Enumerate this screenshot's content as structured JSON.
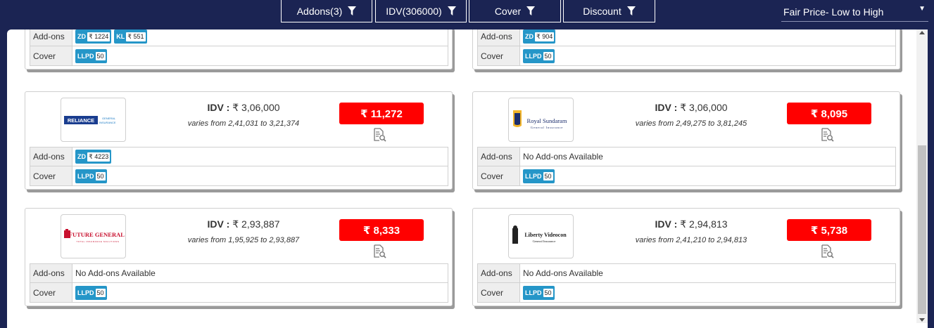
{
  "filters": {
    "addons": "Addons(3)",
    "idv": "IDV(306000)",
    "cover": "Cover",
    "discount": "Discount"
  },
  "sort": {
    "selected": "Fair Price- Low to High"
  },
  "labels": {
    "addons": "Add-ons",
    "cover": "Cover",
    "idv_label": "IDV :",
    "no_addons": "No Add-ons Available"
  },
  "partial_cards": [
    {
      "addon_tags": [
        {
          "code": "ZD",
          "value": "₹ 1224"
        },
        {
          "code": "KL",
          "value": "₹ 551"
        }
      ],
      "cover_tag": {
        "code": "LLPD",
        "value": "50"
      }
    },
    {
      "addon_tags": [
        {
          "code": "ZD",
          "value": "₹ 904"
        }
      ],
      "cover_tag": {
        "code": "LLPD",
        "value": "50"
      }
    }
  ],
  "quotes": [
    {
      "logo_icon": "reliance-general-insurance-logo",
      "logo_text": "RELIANCE",
      "logo_sub": "GENERAL INSURANCE",
      "idv": "₹ 3,06,000",
      "range": "varies from 2,41,031 to 3,21,374",
      "price": "₹ 11,272",
      "addon_tags": [
        {
          "code": "ZD",
          "value": "₹ 4223"
        }
      ],
      "addons_text": "",
      "cover_tag": {
        "code": "LLPD",
        "value": "50"
      }
    },
    {
      "logo_icon": "royal-sundaram-logo",
      "logo_text": "Royal Sundaram",
      "logo_sub": "General Insurance",
      "idv": "₹ 3,06,000",
      "range": "varies from 2,49,275 to 3,81,245",
      "price": "₹ 8,095",
      "addon_tags": [],
      "addons_text": "No Add-ons Available",
      "cover_tag": {
        "code": "LLPD",
        "value": "50"
      }
    },
    {
      "logo_icon": "future-generali-logo",
      "logo_text": "FUTURE GENERALI",
      "logo_sub": "TOTAL INSURANCE SOLUTIONS",
      "idv": "₹ 2,93,887",
      "range": "varies from 1,95,925 to 2,93,887",
      "price": "₹ 8,333",
      "addon_tags": [],
      "addons_text": "No Add-ons Available",
      "cover_tag": {
        "code": "LLPD",
        "value": "50"
      }
    },
    {
      "logo_icon": "liberty-videocon-logo",
      "logo_text": "Liberty Videocon",
      "logo_sub": "General Insurance",
      "idv": "₹ 2,94,813",
      "range": "varies from 2,41,210 to 2,94,813",
      "price": "₹ 5,738",
      "addon_tags": [],
      "addons_text": "No Add-ons Available",
      "cover_tag": {
        "code": "LLPD",
        "value": "50"
      }
    }
  ]
}
